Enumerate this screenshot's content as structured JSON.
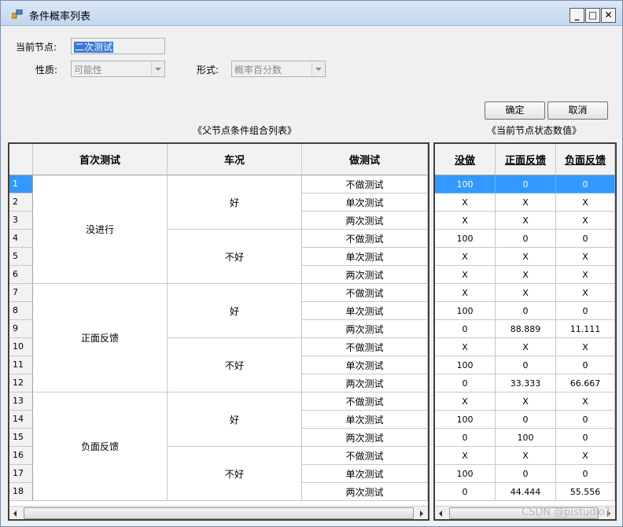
{
  "window": {
    "title": "条件概率列表",
    "buttons": {
      "minimize": "_",
      "maximize": "□",
      "close": "✕"
    }
  },
  "form": {
    "node_label": "当前节点:",
    "node_value": "二次测试",
    "nature_label": "性质:",
    "nature_value": "可能性",
    "form_label": "形式:",
    "form_value": "概率百分数",
    "ok_label": "确定",
    "cancel_label": "取消"
  },
  "captions": {
    "parent_list": "《父节点条件组合列表》",
    "state_values": "《当前节点状态数值》"
  },
  "left_grid": {
    "columns": [
      "首次测试",
      "车况",
      "做测试"
    ],
    "row_numbers": [
      "1",
      "2",
      "3",
      "4",
      "5",
      "6",
      "7",
      "8",
      "9",
      "10",
      "11",
      "12",
      "13",
      "14",
      "15",
      "16",
      "17",
      "18"
    ],
    "first_test_groups": [
      "没进行",
      "正面反馈",
      "负面反馈"
    ],
    "car_groups": [
      "好",
      "不好",
      "好",
      "不好",
      "好",
      "不好"
    ],
    "do_test": [
      "不做测试",
      "单次测试",
      "两次测试",
      "不做测试",
      "单次测试",
      "两次测试",
      "不做测试",
      "单次测试",
      "两次测试",
      "不做测试",
      "单次测试",
      "两次测试",
      "不做测试",
      "单次测试",
      "两次测试",
      "不做测试",
      "单次测试",
      "两次测试"
    ]
  },
  "right_grid": {
    "columns": [
      "没做",
      "正面反馈",
      "负面反馈"
    ],
    "rows": [
      [
        "100",
        "0",
        "0"
      ],
      [
        "X",
        "X",
        "X"
      ],
      [
        "X",
        "X",
        "X"
      ],
      [
        "100",
        "0",
        "0"
      ],
      [
        "X",
        "X",
        "X"
      ],
      [
        "X",
        "X",
        "X"
      ],
      [
        "X",
        "X",
        "X"
      ],
      [
        "100",
        "0",
        "0"
      ],
      [
        "0",
        "88.889",
        "11.111"
      ],
      [
        "X",
        "X",
        "X"
      ],
      [
        "100",
        "0",
        "0"
      ],
      [
        "0",
        "33.333",
        "66.667"
      ],
      [
        "X",
        "X",
        "X"
      ],
      [
        "100",
        "0",
        "0"
      ],
      [
        "0",
        "100",
        "0"
      ],
      [
        "X",
        "X",
        "X"
      ],
      [
        "100",
        "0",
        "0"
      ],
      [
        "0",
        "44.444",
        "55.556"
      ]
    ]
  },
  "watermark": "CSDN @plstudio1"
}
